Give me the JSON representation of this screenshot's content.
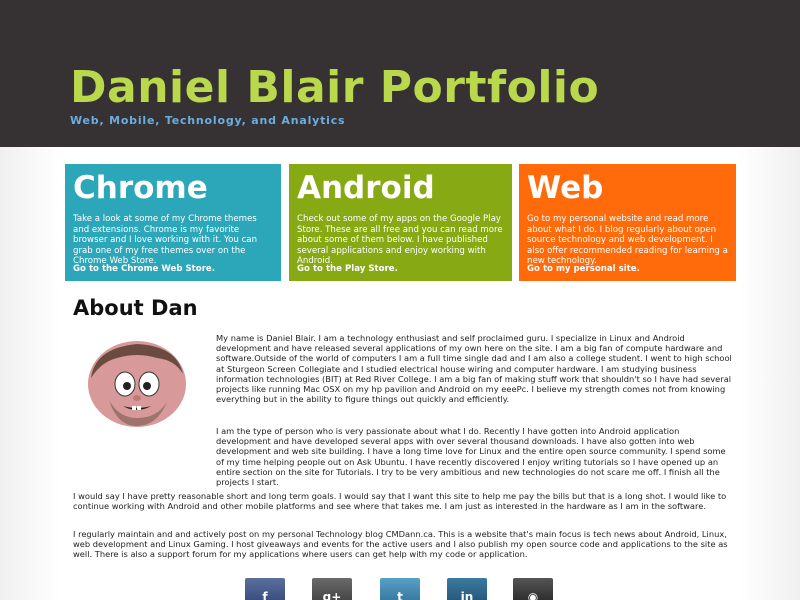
{
  "header": {
    "title": "Daniel Blair Portfolio",
    "subtitle": "Web, Mobile, Technology, and Analytics"
  },
  "cards": [
    {
      "title": "Chrome",
      "text": "Take a look at some of my Chrome themes and extensions. Chrome is my favorite browser and I love working with it. You can grab one of my free themes over on the Chrome Web Store.",
      "link": "Go to the Chrome Web Store.",
      "color": "#2ca6b9"
    },
    {
      "title": "Android",
      "text": "Check out some of my apps on the Google Play Store. These are all free and you can read more about some of them below. I have published several applications and enjoy working with Android.",
      "link": "Go to the Play Store.",
      "color": "#87a913"
    },
    {
      "title": "Web",
      "text": "Go to my personal website and read more about what I do. I blog regularly about open source technology and web development. I also offer recommended reading for learning a new technology.",
      "link": "Go to my personal site.",
      "color": "#ff6a0b"
    }
  ],
  "about": {
    "heading": "About Dan",
    "paragraphs": [
      "My name is Daniel Blair. I am a technology enthusiast and self proclaimed guru. I specialize in Linux and Android development and have released several applications of my own here on the site. I am a big fan of compute hardware and software.Outside of the world of computers I am a full time single dad and I am also a college student. I went to high school at Sturgeon Screen Collegiate and I studied electrical house wiring and computer hardware. I am studying business information technologies (BIT) at Red River College. I am a big fan of making stuff work that shouldn't so I have had several projects like running Mac OSX on my hp pavilion and Android on my eeePc. I believe my strength comes not from knowing everything but in the ability to figure things out quickly and efficiently.",
      "I am the type of person who is very passionate about what I do. Recently I have gotten into Android application development and have developed several apps with over several thousand downloads. I have also gotten into web development and web site building. I have a long time love for Linux and the entire open source community. I spend some of my time helping people out on Ask Ubuntu. I have recently discovered I enjoy writing tutorials so I have opened up an entire section on the site for Tutorials. I try to be very ambitious and new technologies do not scare me off. I finish all the projects I start.",
      "I would say I have pretty reasonable short and long term goals. I would say that I want this site to help me pay the bills but that is a long shot. I would like to continue working with Android and other mobile platforms and see where that takes me. I am just as interested in the hardware as I am in the software.",
      "I regularly maintain and and actively post on my personal Technology blog CMDann.ca. This is a website that's main focus is tech news about Android, Linux, web development and Linux Gaming. I host giveaways and events for the active users and I also publish my open source code and applications to the site as well. There is also a support forum for my applications where users can get help with my code or application."
    ]
  },
  "social": [
    {
      "icon": "facebook-icon",
      "glyph": "f"
    },
    {
      "icon": "google-plus-icon",
      "glyph": "g+"
    },
    {
      "icon": "twitter-icon",
      "glyph": "t"
    },
    {
      "icon": "linkedin-icon",
      "glyph": "in"
    },
    {
      "icon": "github-icon",
      "glyph": "◉"
    }
  ]
}
